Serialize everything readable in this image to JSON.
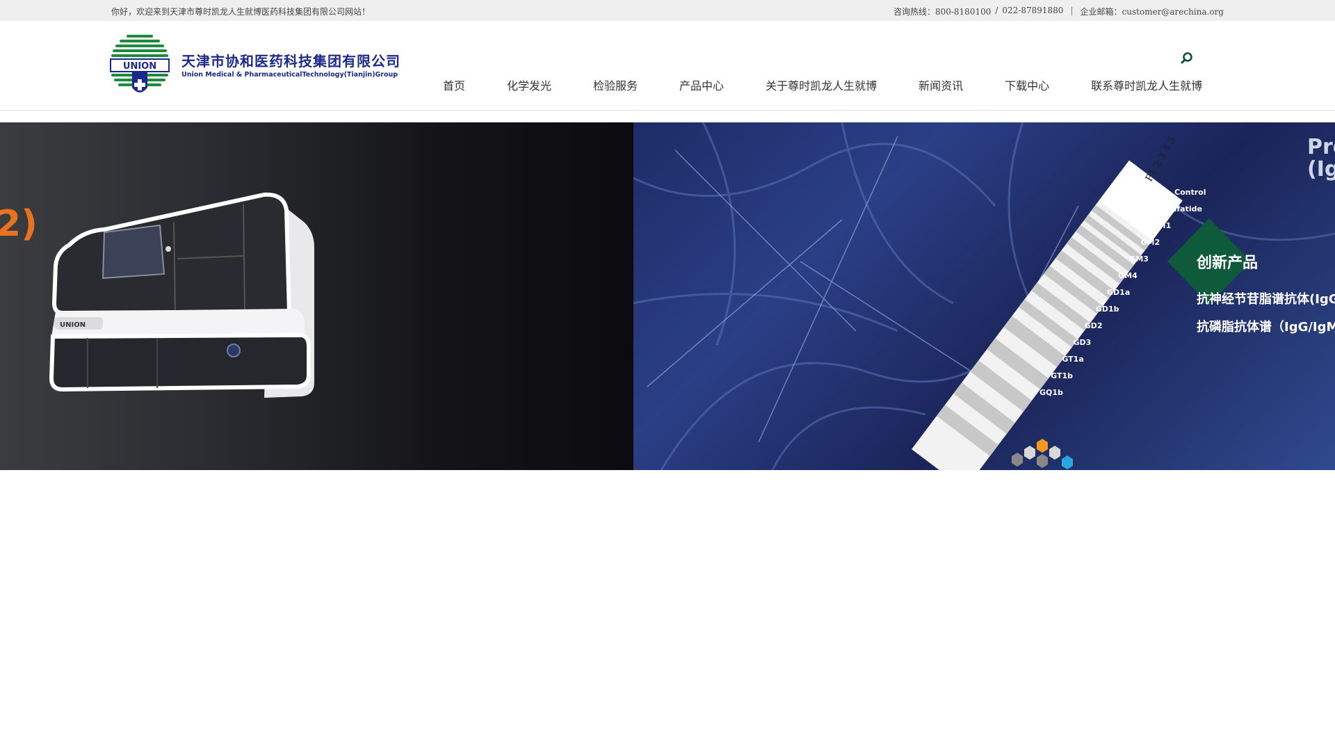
{
  "topbar": {
    "welcome": "你好，欢迎来到天津市尊时凯龙人生就博医药科技集团有限公司网站！",
    "hotline_label": "咨询热线：800-8180100",
    "hotline_slash": "/",
    "hotline2": "022-87891880",
    "divider": "|",
    "email_label": "企业邮箱：customer@arechina.org"
  },
  "logo": {
    "emblem_text": "UNION",
    "name_cn": "天津市协和医药科技集团有限公司",
    "name_en": "Union Medical & PharmaceuticalTechnology(Tianjin)Group"
  },
  "nav": {
    "items": [
      {
        "label": "首页"
      },
      {
        "label": "化学发光"
      },
      {
        "label": "检验服务"
      },
      {
        "label": "产品中心"
      },
      {
        "label": "关于尊时凯龙人生就博"
      },
      {
        "label": "新闻资讯"
      },
      {
        "label": "下载中心"
      },
      {
        "label": "联系尊时凯龙人生就博"
      }
    ],
    "search_icon": "search-icon"
  },
  "banner": {
    "left_fragment": "2)",
    "machine_label": "UNION",
    "strip_header": "P1 2 3 4 5",
    "strip_labels": [
      "Control",
      "Sulfatide",
      "GM1",
      "GM2",
      "GM3",
      "GM4",
      "GD1a",
      "GD1b",
      "GD2",
      "GD3",
      "GT1a",
      "GT1b",
      "GQ1b"
    ],
    "corner_text_1": "Pro",
    "corner_text_2": "(Ig",
    "badge": "创新产品",
    "product_1": "抗神经节苷脂谱抗体(IgG",
    "product_2": "抗磷脂抗体谱（IgG/IgM)"
  },
  "colors": {
    "brand_blue": "#1b2a8a",
    "brand_green": "#1e8a3e",
    "accent_orange": "#e8731f",
    "badge_green": "#0f5a3a"
  }
}
